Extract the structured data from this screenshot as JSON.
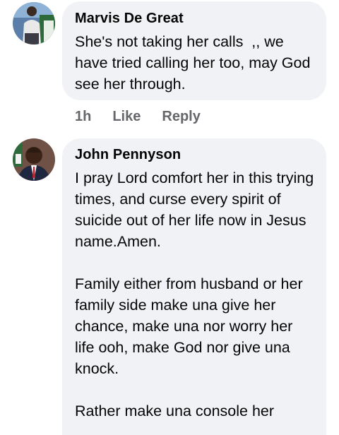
{
  "comments": [
    {
      "author": "Marvis De Great",
      "text": "She's not taking her calls  ,, we have tried calling her too, may God see her through.",
      "time": "1h",
      "like_label": "Like",
      "reply_label": "Reply"
    },
    {
      "author": "John Pennyson",
      "paragraphs": [
        "I pray Lord comfort her in this trying times, and curse every spirit of suicide out of her life now in Jesus name.Amen.",
        "Family either from husband or her family side make una give her chance, make una nor worry her life ooh, make God nor give una knock.",
        "Rather make una console her"
      ]
    }
  ],
  "colors": {
    "bubble_bg": "#f0f2f5",
    "secondary_text": "#65676b",
    "primary_text": "#050505"
  }
}
